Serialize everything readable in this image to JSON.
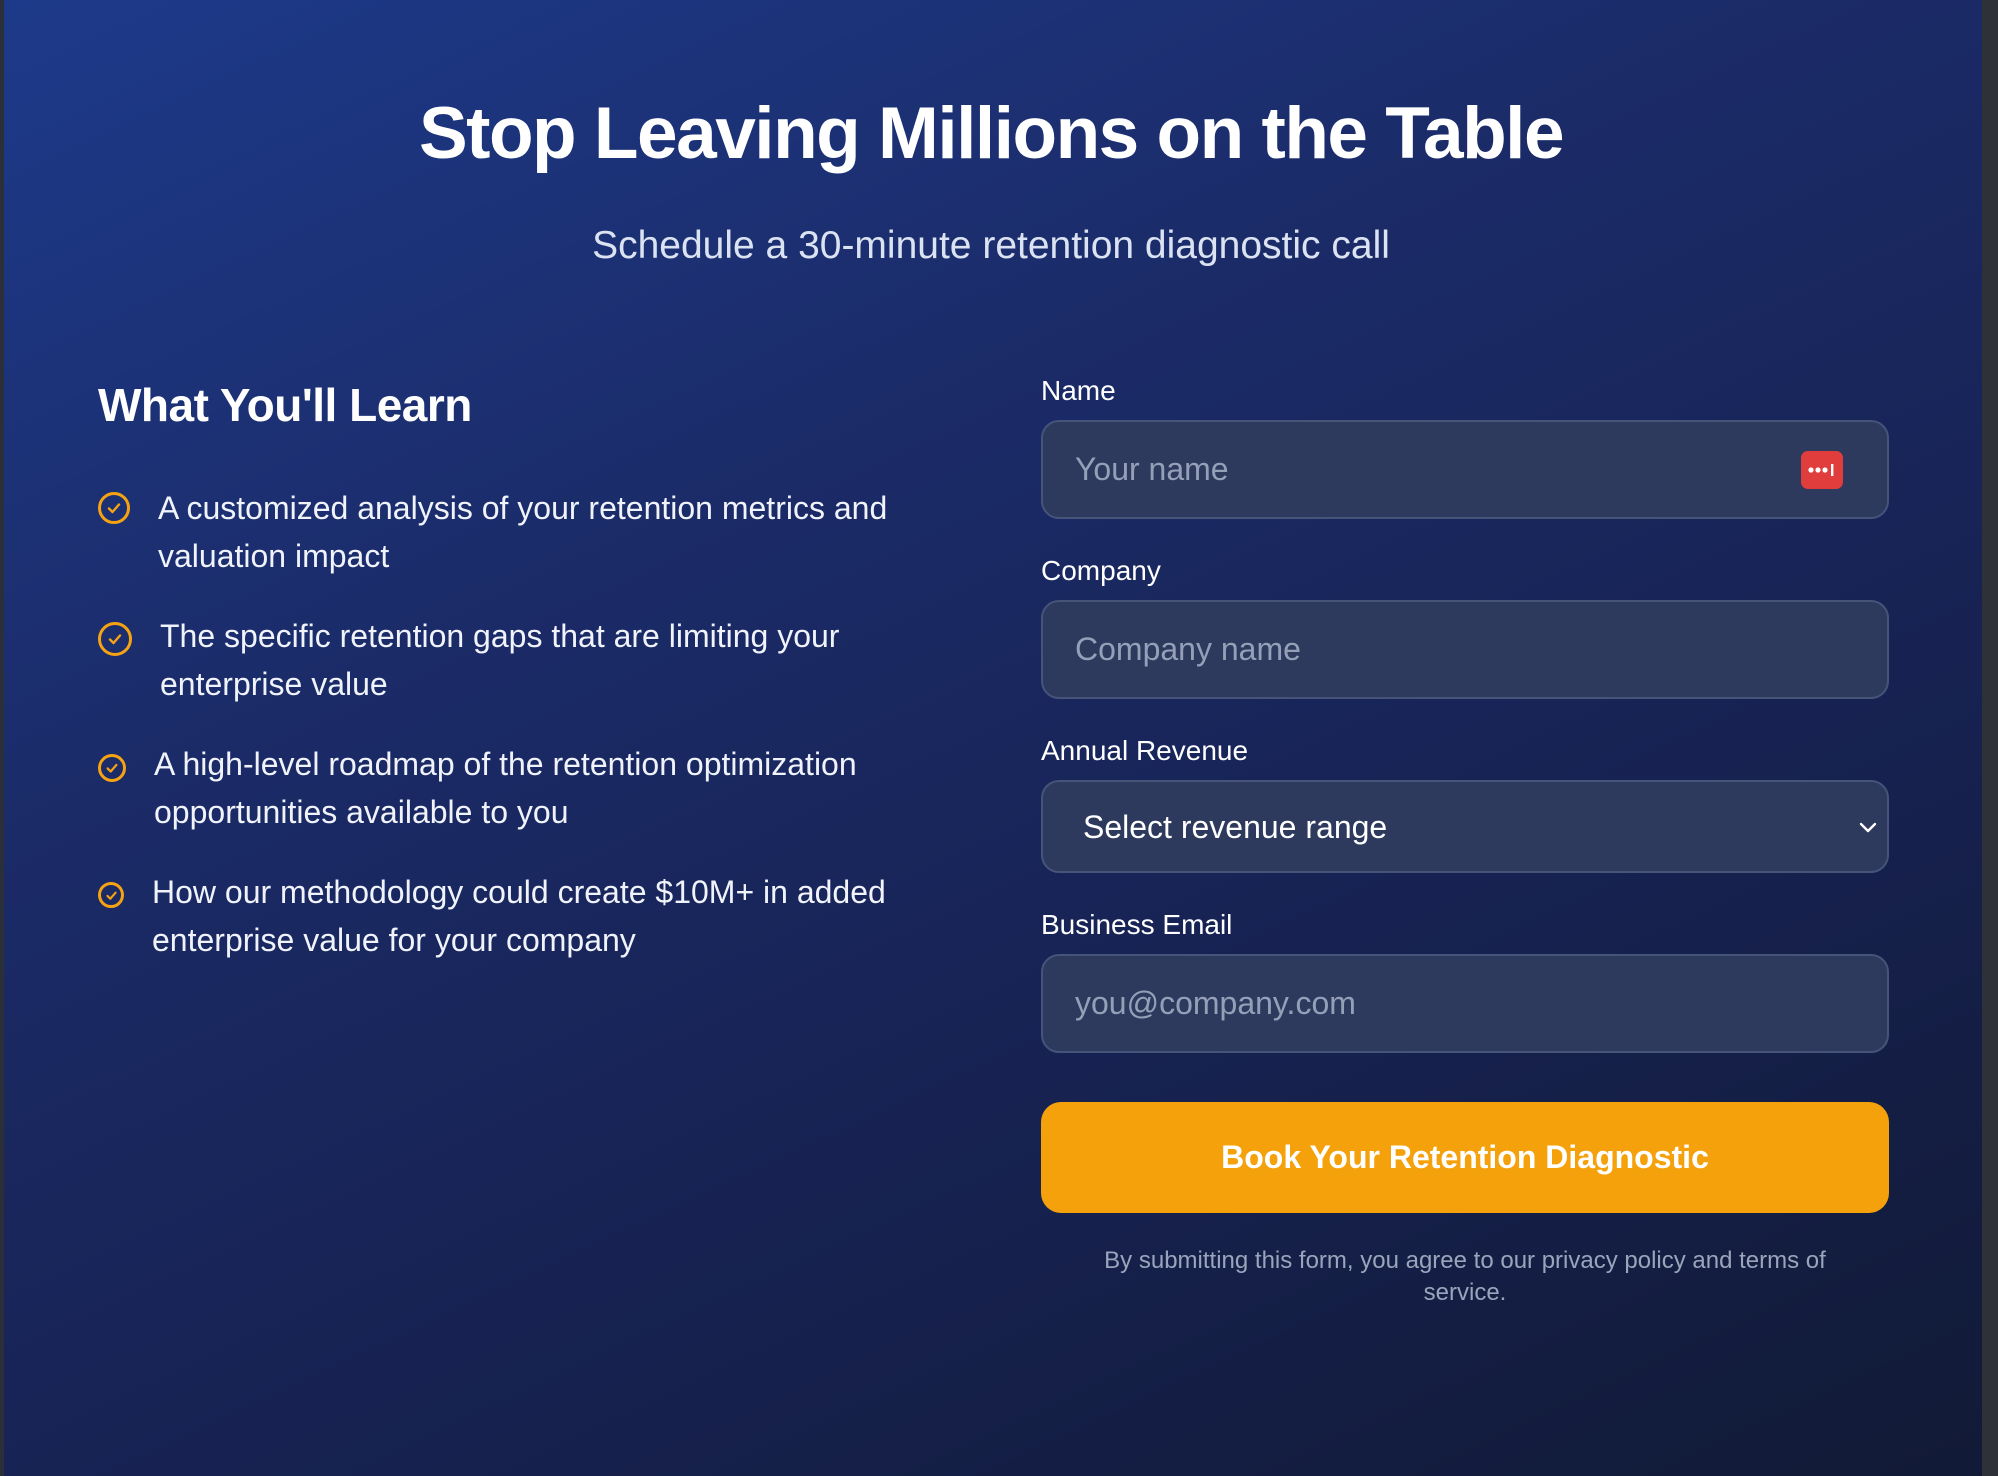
{
  "hero": {
    "title": "Stop Leaving Millions on the Table",
    "subtitle": "Schedule a 30-minute retention diagnostic call"
  },
  "learn": {
    "heading": "What You'll Learn",
    "check_icon": "check-circle-icon",
    "items": [
      {
        "text": "A customized analysis of your retention metrics and valuation impact"
      },
      {
        "text": "The specific retention gaps that are limiting your enterprise value"
      },
      {
        "text": "A high-level roadmap of the retention optimization opportunities available to you"
      },
      {
        "text": "How our methodology could create $10M+ in added enterprise value for your company"
      }
    ]
  },
  "form": {
    "name": {
      "label": "Name",
      "placeholder": "Your name",
      "value": ""
    },
    "company": {
      "label": "Company",
      "placeholder": "Company name",
      "value": ""
    },
    "revenue": {
      "label": "Annual Revenue",
      "selected": "Select revenue range"
    },
    "email": {
      "label": "Business Email",
      "placeholder": "you@company.com",
      "value": ""
    },
    "submit_label": "Book Your Retention Diagnostic",
    "disclaimer": "By submitting this form, you agree to our privacy policy and terms of service."
  },
  "colors": {
    "accent": "#f5a10c",
    "background_start": "#1d3a8a",
    "background_end": "#111a35",
    "input_background": "#2d3a5e",
    "password_manager_icon": "#e23d3d"
  },
  "icons": {
    "password_manager": "password-manager-icon",
    "select_chevron": "chevron-down-icon"
  }
}
